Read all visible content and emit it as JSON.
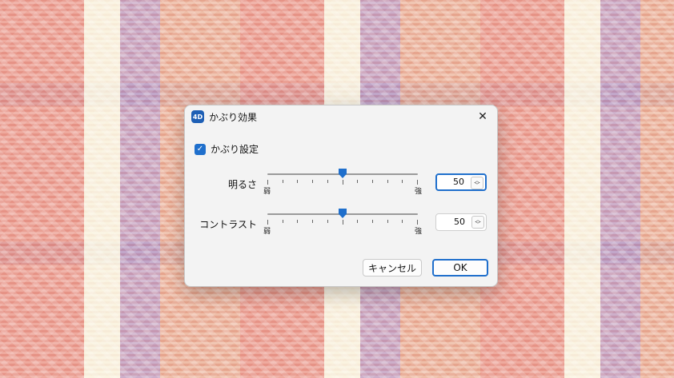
{
  "dialog": {
    "title": "かぶり効果",
    "app_icon_text": "4D",
    "close_glyph": "✕"
  },
  "checkbox": {
    "label": "かぶり設定",
    "checked": true
  },
  "brightness": {
    "label": "明るさ",
    "value": "50",
    "min_label": "弱",
    "max_label": "強",
    "level_percent": 50
  },
  "contrast": {
    "label": "コントラスト",
    "value": "50",
    "min_label": "弱",
    "max_label": "強",
    "level_percent": 50
  },
  "buttons": {
    "cancel": "キャンセル",
    "ok": "OK"
  },
  "colors": {
    "accent": "#1f6fcc"
  }
}
